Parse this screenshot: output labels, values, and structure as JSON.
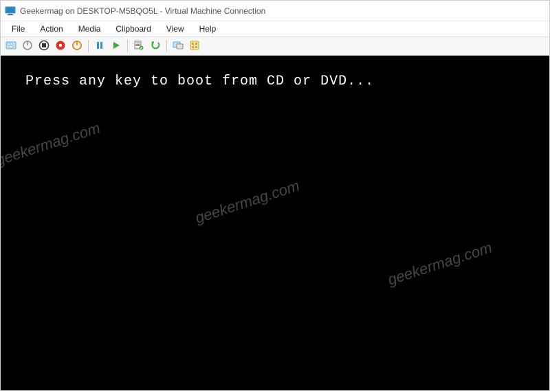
{
  "window": {
    "title": "Geekermag on DESKTOP-M5BQO5L - Virtual Machine Connection"
  },
  "menu": {
    "items": [
      "File",
      "Action",
      "Media",
      "Clipboard",
      "View",
      "Help"
    ]
  },
  "toolbar": {
    "buttons": [
      {
        "name": "ctrl-alt-del-button",
        "icon": "ctrl-alt-del-icon"
      },
      {
        "name": "turnoff-button",
        "icon": "turnoff-icon"
      },
      {
        "name": "shutdown-button",
        "icon": "shutdown-icon"
      },
      {
        "name": "save-button",
        "icon": "save-icon"
      },
      {
        "name": "power-button",
        "icon": "power-icon"
      },
      {
        "separator": true
      },
      {
        "name": "pause-button",
        "icon": "pause-icon"
      },
      {
        "name": "start-button",
        "icon": "start-icon"
      },
      {
        "separator": true
      },
      {
        "name": "checkpoint-button",
        "icon": "checkpoint-icon"
      },
      {
        "name": "revert-button",
        "icon": "revert-icon"
      },
      {
        "separator": true
      },
      {
        "name": "enhanced-session-button",
        "icon": "enhanced-session-icon"
      },
      {
        "name": "share-button",
        "icon": "share-icon"
      }
    ]
  },
  "vm": {
    "boot_message": "Press any key to boot from CD or DVD..."
  },
  "watermark": "geekermag.com"
}
